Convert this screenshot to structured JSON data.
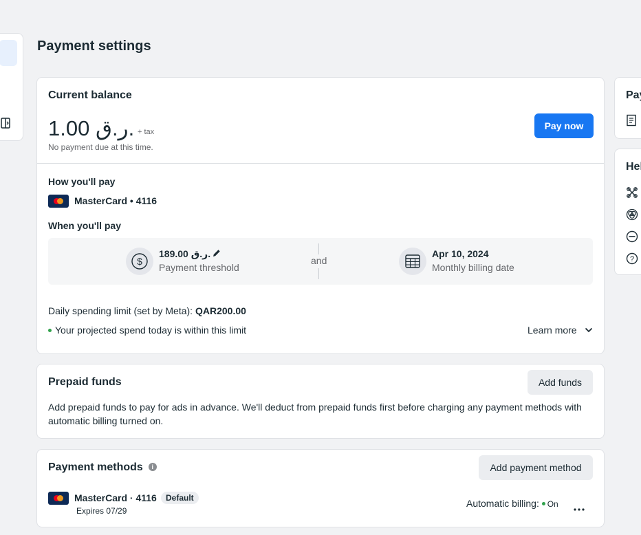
{
  "page": {
    "title": "Payment settings"
  },
  "balance": {
    "title": "Current balance",
    "amount": "1.00 ر.ق.",
    "tax": "+ tax",
    "status": "No payment due at this time.",
    "pay_now_label": "Pay now"
  },
  "how_you_pay": {
    "title": "How you'll pay",
    "card": "MasterCard • 4116"
  },
  "when_you_pay": {
    "title": "When you'll pay",
    "threshold_value": "189.00 ر.ق.",
    "threshold_label": "Payment threshold",
    "and_label": "and",
    "billing_date": "Apr 10, 2024",
    "billing_label": "Monthly billing date"
  },
  "spending": {
    "limit_prefix": "Daily spending limit (set by Meta): ",
    "limit_value": "QAR200.00",
    "projection": "Your projected spend today is within this limit",
    "learn_more": "Learn more"
  },
  "prepaid": {
    "title": "Prepaid funds",
    "add_funds_label": "Add funds",
    "description": "Add prepaid funds to pay for ads in advance. We'll deduct from prepaid funds first before charging any payment methods with automatic billing turned on."
  },
  "methods": {
    "title": "Payment methods",
    "info": "i",
    "add_label": "Add payment method",
    "card_name": "MasterCard · 4116",
    "default_badge": "Default",
    "expires": "Expires 07/29",
    "auto_billing_label": "Automatic billing:",
    "auto_billing_value": "On"
  },
  "right_panel": {
    "card1_title": "Pay",
    "card2_title": "Hel"
  },
  "colors": {
    "primary": "#1877f2",
    "success": "#31a24c",
    "mastercard_bg": "#0e2a56"
  }
}
